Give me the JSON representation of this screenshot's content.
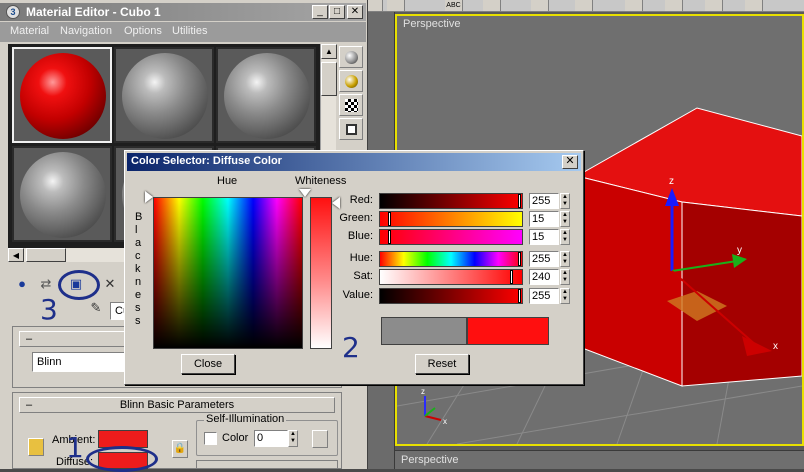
{
  "material_editor": {
    "title": "Material Editor - Cubo 1",
    "menu": [
      "Material",
      "Navigation",
      "Options",
      "Utilities"
    ],
    "slots": [
      {
        "color": "red",
        "active": true
      },
      {
        "color": "grey",
        "active": false
      },
      {
        "color": "grey",
        "active": false
      },
      {
        "color": "grey",
        "active": false
      },
      {
        "color": "grey",
        "active": false
      },
      {
        "color": "grey",
        "active": false
      }
    ],
    "material_name": "Cu",
    "shader_type": "Blinn",
    "rollout_blinn": "Blinn Basic Parameters",
    "self_illumination": {
      "title": "Self-Illumination",
      "color_label": "Color",
      "value": "0"
    },
    "ambient_label": "Ambient:",
    "diffuse_label": "Diffuse:",
    "colors": {
      "diffuse": "#ee1c1c",
      "ambient": "#ee1c1c"
    }
  },
  "annotations": {
    "one": "1",
    "two": "2",
    "three": "3"
  },
  "color_selector": {
    "title": "Color Selector: Diffuse Color",
    "hue_label": "Hue",
    "whiteness_label": "Whiteness",
    "blackness_label": "Blackness",
    "channels": [
      {
        "label": "Red:",
        "value": "255",
        "fraction": 1.0
      },
      {
        "label": "Green:",
        "value": "15",
        "fraction": 0.059
      },
      {
        "label": "Blue:",
        "value": "15",
        "fraction": 0.059
      },
      {
        "label": "Hue:",
        "value": "255",
        "fraction": 1.0
      },
      {
        "label": "Sat:",
        "value": "240",
        "fraction": 0.941
      },
      {
        "label": "Value:",
        "value": "255",
        "fraction": 1.0
      }
    ],
    "close_label": "Close",
    "reset_label": "Reset",
    "original_color": "#8c8c8c",
    "new_color": "#ff0f0f"
  },
  "viewports": {
    "main_label": "Perspective",
    "bottom_label": "Perspective",
    "cube_color": "#cc0000",
    "axis_labels": {
      "x": "x",
      "y": "y",
      "z": "z"
    },
    "toolbar_text": "ABC"
  }
}
